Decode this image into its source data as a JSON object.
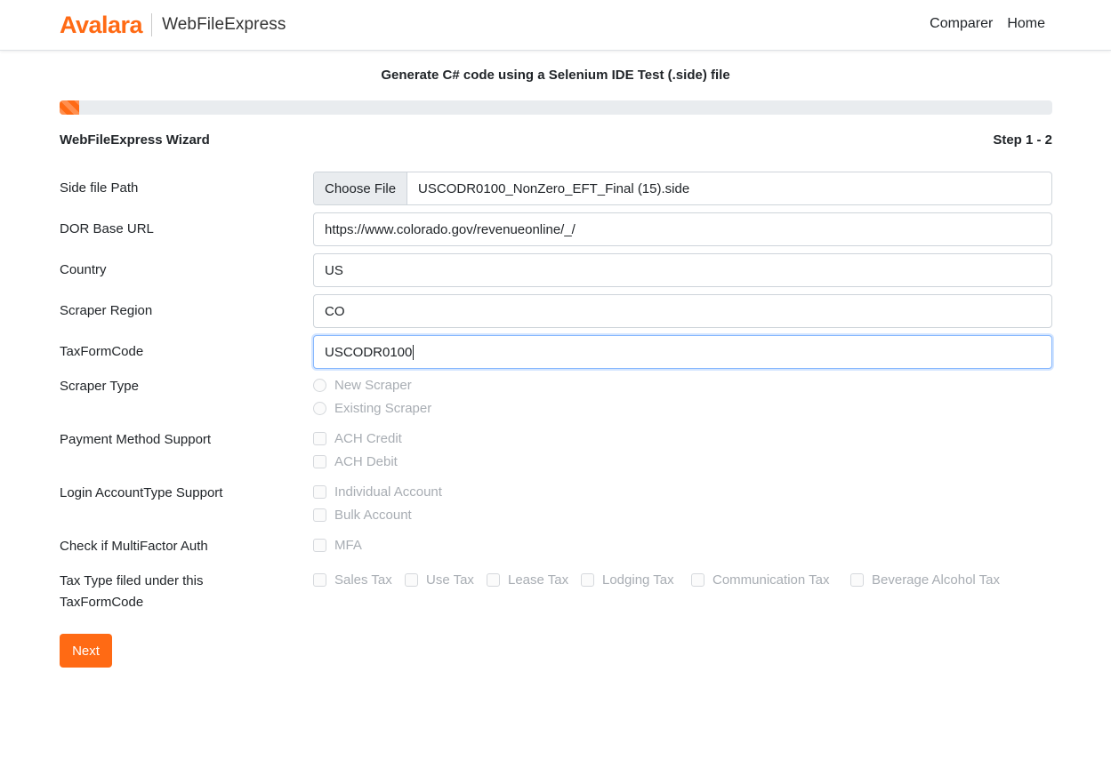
{
  "header": {
    "logo_text": "Avalara",
    "app_name": "WebFileExpress",
    "nav": [
      "Comparer",
      "Home"
    ]
  },
  "page_title": "Generate C# code using a Selenium IDE Test (.side) file",
  "progress": {
    "percent": 2,
    "color": "#ff6a14"
  },
  "wizard": {
    "title": "WebFileExpress Wizard",
    "step": "Step 1 - 2"
  },
  "form": {
    "side_file": {
      "label": "Side file Path",
      "button": "Choose File",
      "file_name": "USCODR0100_NonZero_EFT_Final (15).side"
    },
    "dor_url": {
      "label": "DOR Base URL",
      "value": "https://www.colorado.gov/revenueonline/_/"
    },
    "country": {
      "label": "Country",
      "value": "US"
    },
    "region": {
      "label": "Scraper Region",
      "value": "CO"
    },
    "tax_form_code": {
      "label": "TaxFormCode",
      "value": "USCODR0100"
    },
    "scraper_type": {
      "label": "Scraper Type",
      "options": [
        "New Scraper",
        "Existing Scraper"
      ]
    },
    "payment_method": {
      "label": "Payment Method Support",
      "options": [
        "ACH Credit",
        "ACH Debit"
      ]
    },
    "login_account": {
      "label": "Login AccountType Support",
      "options": [
        "Individual Account",
        "Bulk Account"
      ]
    },
    "mfa": {
      "label": "Check if MultiFactor Auth",
      "option": "MFA"
    },
    "tax_type": {
      "label_line1": "Tax Type filed under this",
      "label_line2": "TaxFormCode",
      "options": [
        "Sales Tax",
        "Use Tax",
        "Lease Tax",
        "Lodging Tax",
        "Communication Tax",
        "Beverage Alcohol Tax"
      ]
    }
  },
  "next_button": "Next",
  "colors": {
    "accent": "#ff6a14",
    "disabled_text": "#a8adb3",
    "border": "#ced4da"
  }
}
